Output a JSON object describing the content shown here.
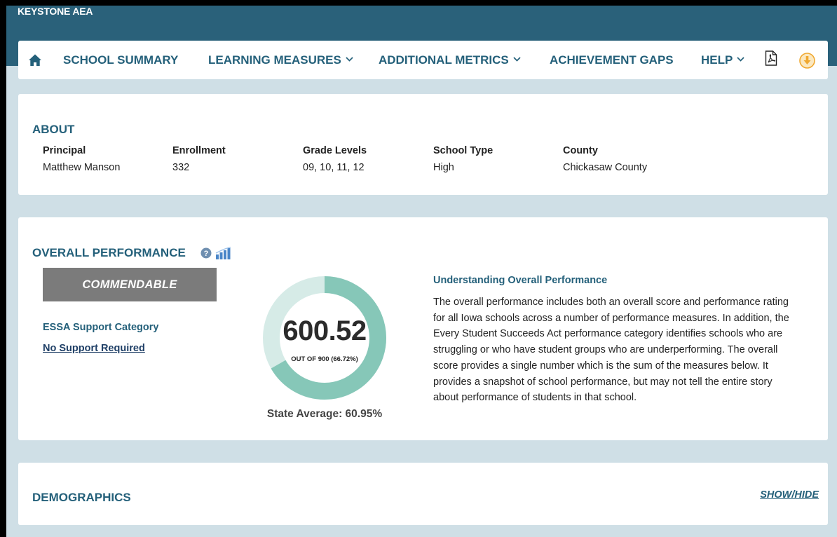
{
  "header": {
    "region": "KEYSTONE AEA"
  },
  "nav": {
    "home_icon": "home-icon",
    "items": [
      {
        "label": "SCHOOL SUMMARY",
        "dropdown": false
      },
      {
        "label": "LEARNING MEASURES",
        "dropdown": true
      },
      {
        "label": "ADDITIONAL METRICS",
        "dropdown": true
      },
      {
        "label": "ACHIEVEMENT GAPS",
        "dropdown": false
      },
      {
        "label": "HELP",
        "dropdown": true
      }
    ],
    "pdf_icon": "pdf-icon",
    "download_icon": "download-icon",
    "download_color": "#f0a830"
  },
  "about": {
    "title": "ABOUT",
    "fields": [
      {
        "label": "Principal",
        "value": "Matthew Manson"
      },
      {
        "label": "Enrollment",
        "value": "332"
      },
      {
        "label": "Grade Levels",
        "value": "09, 10, 11, 12"
      },
      {
        "label": "School Type",
        "value": "High"
      },
      {
        "label": "County",
        "value": "Chickasaw County"
      }
    ]
  },
  "performance": {
    "title": "OVERALL PERFORMANCE",
    "help_icon": "question-circle-icon",
    "trend_icon": "bar-chart-icon",
    "rating": "COMMENDABLE",
    "rating_color": "#7b7b7b",
    "essa_label": "ESSA Support Category",
    "essa_value": "No Support Required",
    "score": "600.52",
    "score_detail": "OUT OF 900 (66.72%)",
    "score_fraction": 0.6672,
    "ring_fill_color": "#86c7b8",
    "ring_track_color": "#d6ebe7",
    "state_average": "State Average: 60.95%",
    "understanding_title": "Understanding Overall Performance",
    "understanding_text": "The overall performance includes both an overall score and performance rating for all Iowa schools across a number of performance measures. In addition, the Every Student Succeeds Act performance category identifies schools who are struggling or who have student groups who are underperforming. The overall score provides a single number which is the sum of the measures below. It provides a snapshot of school performance, but may not tell the entire story about performance of students in that school."
  },
  "demographics": {
    "title": "DEMOGRAPHICS",
    "toggle_label": "SHOW/HIDE"
  },
  "colors": {
    "header_bg": "#2a617a",
    "page_bg": "#cfdfe6",
    "heading_text": "#24607a"
  }
}
